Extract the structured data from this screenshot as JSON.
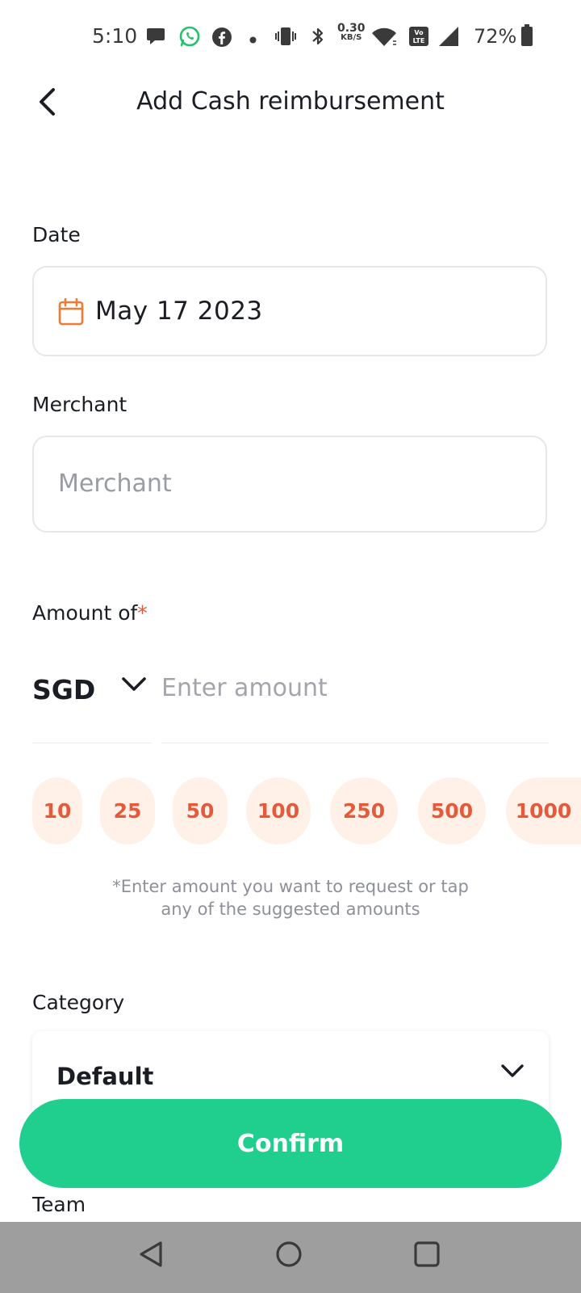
{
  "status_bar": {
    "time": "5:10",
    "net_speed_value": "0.30",
    "net_speed_unit": "KB/S",
    "volte_label": "Vo LTE",
    "battery_percent": "72%"
  },
  "header": {
    "title": "Add Cash reimbursement"
  },
  "date": {
    "label": "Date",
    "value": "May 17 2023"
  },
  "merchant": {
    "label": "Merchant",
    "placeholder": "Merchant",
    "value": ""
  },
  "amount": {
    "label": "Amount of",
    "required_mark": "*",
    "currency": "SGD",
    "placeholder": "Enter amount",
    "value": "",
    "suggestions": [
      "10",
      "25",
      "50",
      "100",
      "250",
      "500",
      "1000"
    ],
    "hint_line1": "*Enter amount you want to request or tap",
    "hint_line2": "any of the suggested amounts"
  },
  "category": {
    "label": "Category",
    "value": "Default"
  },
  "confirm": {
    "label": "Confirm"
  },
  "team": {
    "label": "Team"
  },
  "colors": {
    "accent_green": "#20cf8e",
    "chip_bg": "#fff1e8",
    "chip_text": "#e55a3a",
    "calendar_icon": "#ef7a30",
    "required_star": "#e8583c",
    "nav_bar": "#9e9e9e"
  }
}
